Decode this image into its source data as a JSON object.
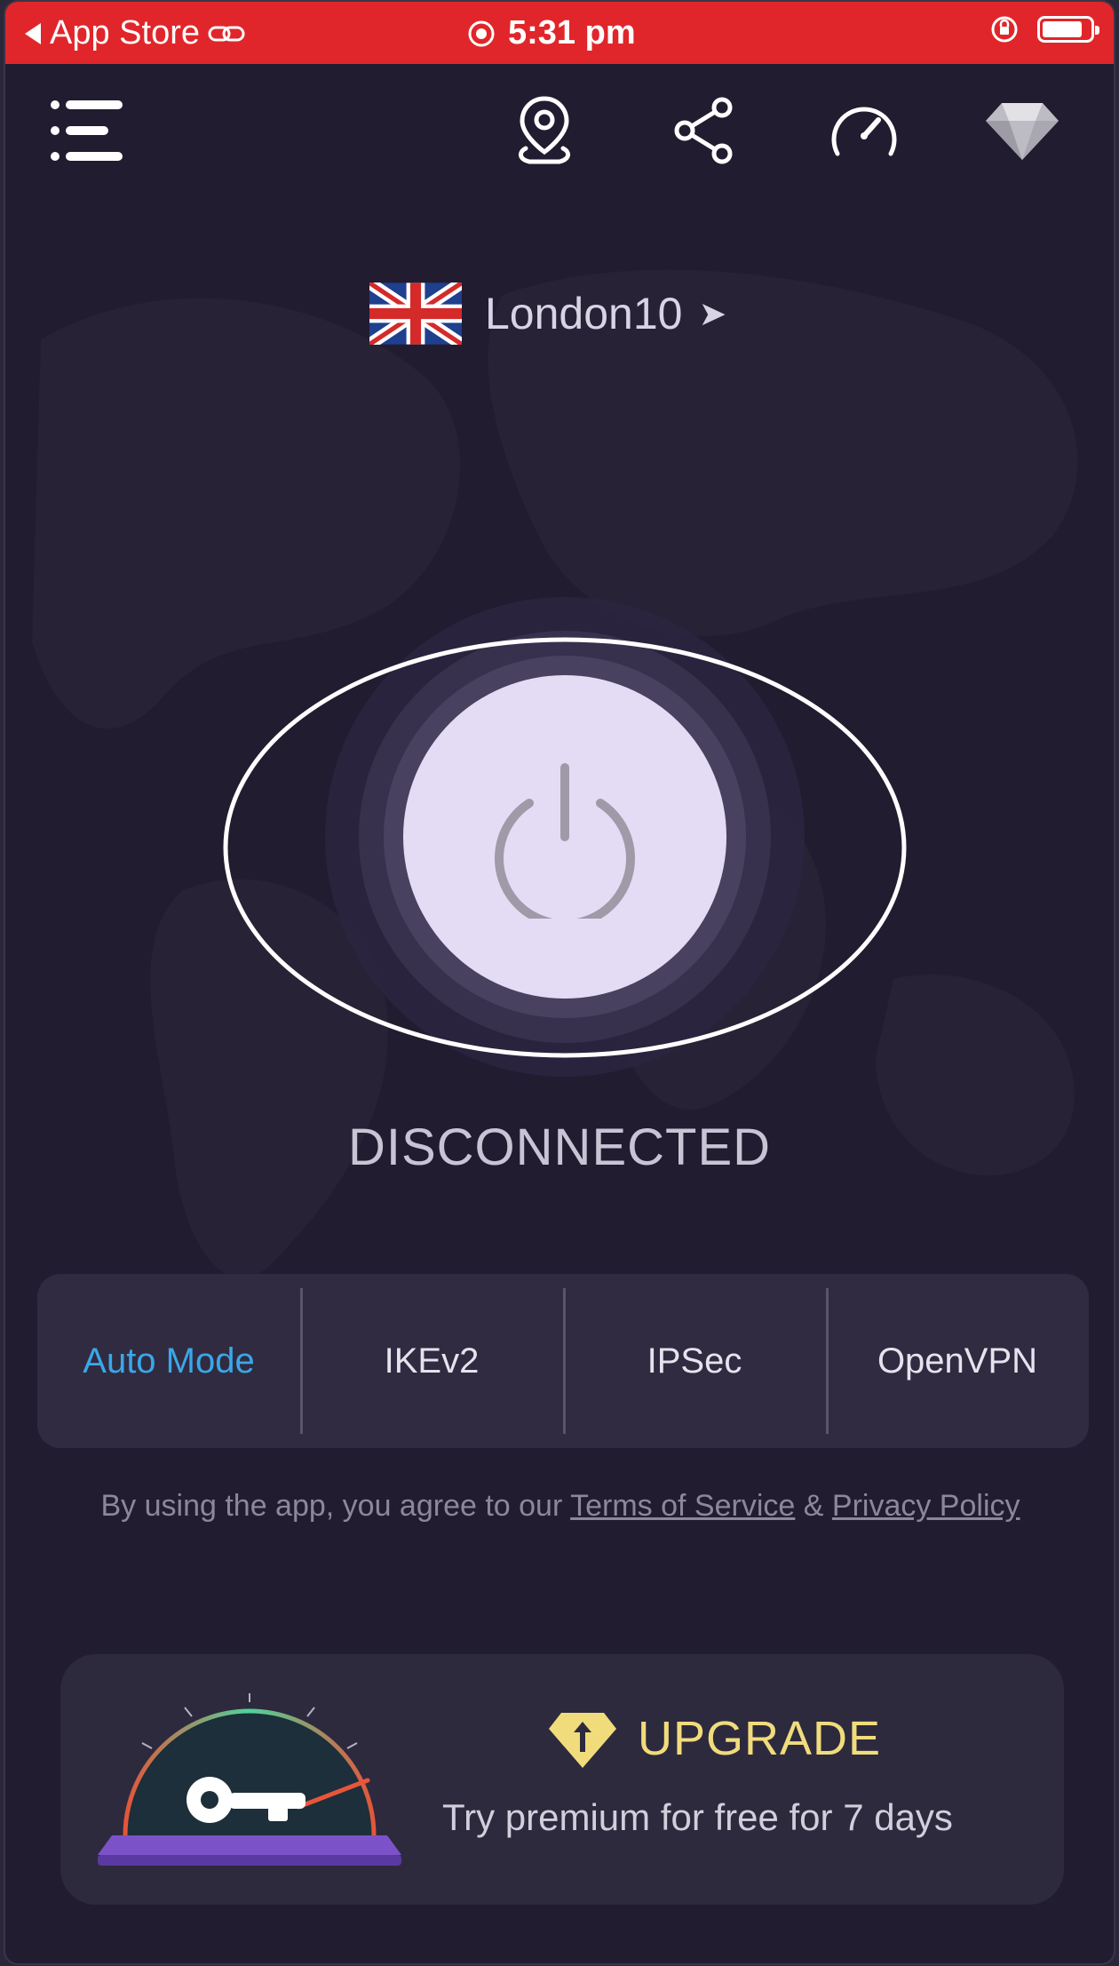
{
  "status_bar": {
    "back_label": "App Store",
    "time": "5:31 pm",
    "background_color": "#e0262a"
  },
  "topnav": {
    "menu_icon": "hamburger-menu-icon",
    "location_icon": "location-pin-icon",
    "share_icon": "share-icon",
    "speed_icon": "speedometer-icon",
    "premium_icon": "diamond-icon"
  },
  "location": {
    "country_flag": "uk-flag-icon",
    "server_name": "London10",
    "chevron": "➤"
  },
  "connection": {
    "state": "DISCONNECTED",
    "button_icon": "power-icon"
  },
  "protocols": {
    "items": [
      {
        "label": "Auto Mode",
        "active": true
      },
      {
        "label": "IKEv2",
        "active": false
      },
      {
        "label": "IPSec",
        "active": false
      },
      {
        "label": "OpenVPN",
        "active": false
      }
    ],
    "active_color": "#3aa7e8"
  },
  "terms": {
    "prefix": "By using the app, you agree to our ",
    "tos_label": "Terms of Service",
    "joiner": " & ",
    "privacy_label": "Privacy Policy"
  },
  "upgrade": {
    "title": "UPGRADE",
    "subtitle": "Try premium for free for 7 days",
    "accent_color": "#f1dc7c"
  }
}
